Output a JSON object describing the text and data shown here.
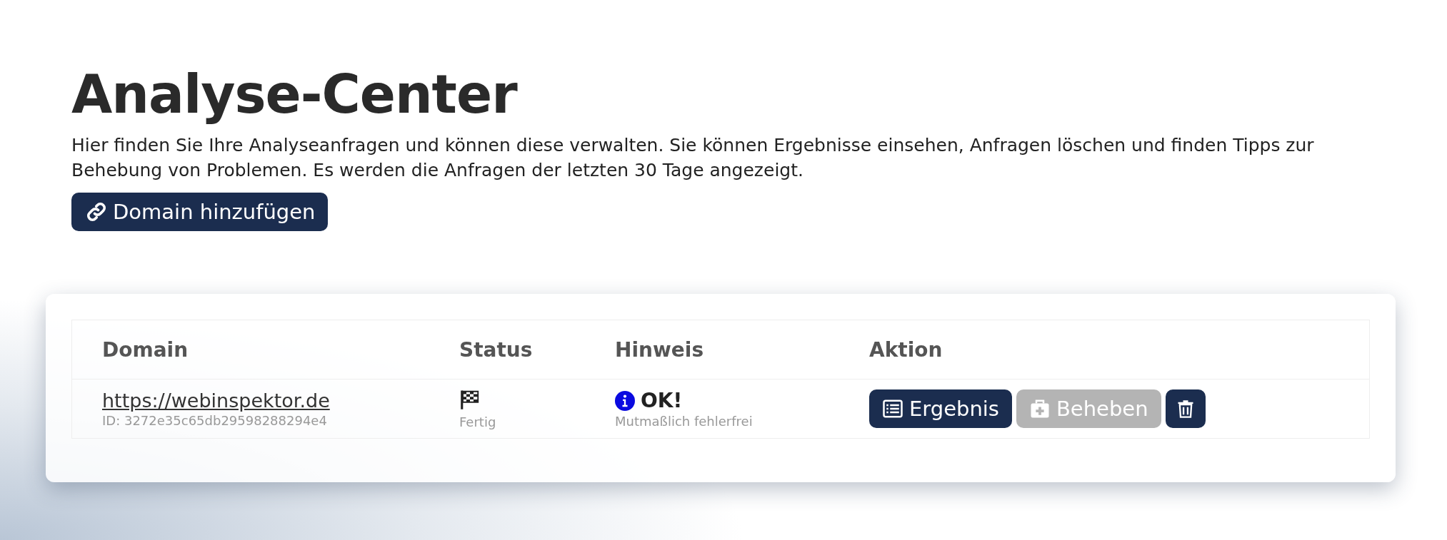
{
  "title": "Analyse-Center",
  "intro": "Hier finden Sie Ihre Analyseanfragen und können diese verwalten. Sie können Ergebnisse einsehen, Anfragen löschen und finden Tipps zur Behebung von Problemen. Es werden die Anfragen der letzten 30 Tage angezeigt.",
  "add_button": "Domain hinzufügen",
  "table": {
    "columns": [
      "Domain",
      "Status",
      "Hinweis",
      "Aktion"
    ],
    "rows": [
      {
        "domain": "https://webinspektor.de",
        "id": "ID: 3272e35c65db29598288294e4",
        "status": "Fertig",
        "hint": "OK!",
        "hint_detail": "Mutmaßlich fehlerfrei",
        "actions": [
          {
            "kind": "result",
            "label": "Ergebnis",
            "disabled": false
          },
          {
            "kind": "fix",
            "label": "Beheben",
            "disabled": true
          },
          {
            "kind": "delete",
            "disabled": false
          }
        ]
      }
    ]
  }
}
